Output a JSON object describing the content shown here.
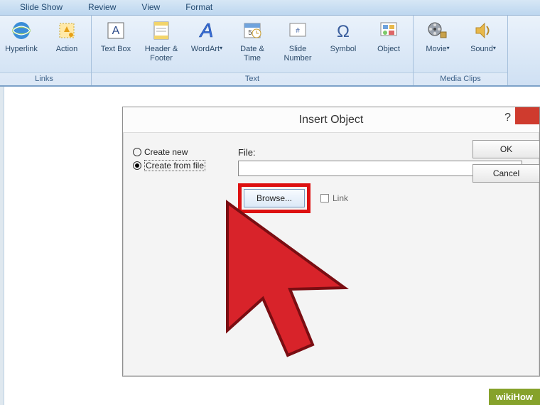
{
  "ribbon_tabs": {
    "slideshow": "Slide Show",
    "review": "Review",
    "view": "View",
    "format": "Format"
  },
  "groups": {
    "links": {
      "title": "Links",
      "hyperlink": "Hyperlink",
      "action": "Action"
    },
    "text": {
      "title": "Text",
      "textbox": "Text Box",
      "header": "Header & Footer",
      "wordart": "WordArt",
      "datetime": "Date & Time",
      "slidenum": "Slide Number",
      "symbol": "Symbol",
      "object": "Object"
    },
    "media": {
      "title": "Media Clips",
      "movie": "Movie",
      "sound": "Sound"
    }
  },
  "dialog": {
    "title": "Insert Object",
    "help": "?",
    "radio_new": "Create new",
    "radio_file": "Create from file",
    "file_label": "File:",
    "browse": "Browse...",
    "link": "Link",
    "ok": "OK",
    "cancel": "Cancel"
  },
  "badge": "wikiHow"
}
